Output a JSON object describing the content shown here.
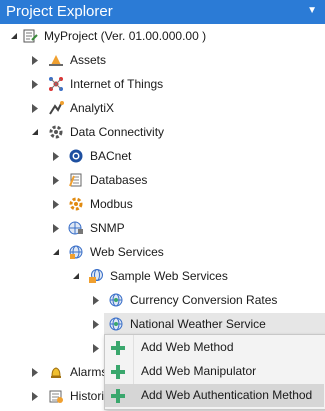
{
  "panel": {
    "title": "Project Explorer"
  },
  "tree": {
    "project": "MyProject (Ver. 01.00.000.00 )",
    "assets": "Assets",
    "iot": "Internet of Things",
    "analytix": "AnalytiX",
    "data_connectivity": "Data Connectivity",
    "bacnet": "BACnet",
    "databases": "Databases",
    "modbus": "Modbus",
    "snmp": "SNMP",
    "web_services": "Web Services",
    "sample_web_services": "Sample Web Services",
    "currency": "Currency Conversion Rates",
    "weather": "National Weather Service",
    "alarms": "Alarms",
    "historian": "Histori"
  },
  "context_menu": {
    "items": [
      "Add Web Method",
      "Add Web Manipulator",
      "Add Web Authentication Method"
    ]
  },
  "colors": {
    "header": "#2b7bd6",
    "selected_row": "#e6e6e6",
    "menu_highlight": "#d6d6d6",
    "plus_icon": "#3aa76d"
  }
}
